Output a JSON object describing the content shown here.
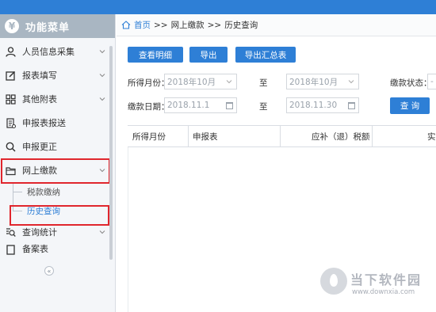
{
  "sidebar": {
    "title": "功能菜单",
    "logo_glyph": "¥",
    "items": [
      {
        "label": "人员信息采集",
        "icon": "person-icon",
        "chevron": true
      },
      {
        "label": "报表填写",
        "icon": "edit-icon",
        "chevron": true
      },
      {
        "label": "其他附表",
        "icon": "grid-icon",
        "chevron": true
      },
      {
        "label": "申报表报送",
        "icon": "document-icon",
        "chevron": false
      },
      {
        "label": "申报更正",
        "icon": "search-icon",
        "chevron": false
      },
      {
        "label": "网上缴款",
        "icon": "folder-icon",
        "chevron": true
      },
      {
        "label": "查询统计",
        "icon": "list-search-icon",
        "chevron": true
      },
      {
        "label": "备案表",
        "icon": "binder-icon",
        "chevron": true
      }
    ],
    "sub_items": [
      {
        "label": "税款缴纳",
        "active": false
      },
      {
        "label": "历史查询",
        "active": true
      }
    ],
    "collapse_glyph": "«"
  },
  "breadcrumb": {
    "home": "首页",
    "sep": ">>",
    "level1": "网上缴款",
    "level2": "历史查询"
  },
  "toolbar": {
    "view_detail": "查看明细",
    "export": "导出",
    "export_summary": "导出汇总表"
  },
  "filters": {
    "month_label": "所得月份：",
    "month_from": "2018年10月",
    "to_label": "至",
    "month_to": "2018年10月",
    "status_label": "缴款状态：",
    "status_value": "-",
    "date_label": "缴款日期：",
    "date_from": "2018.11.1",
    "date_to": "2018.11.30",
    "query_button": "查 询"
  },
  "table": {
    "columns": [
      "所得月份",
      "申报表",
      "应补（退）税额",
      "实"
    ]
  },
  "watermark": {
    "text": "当下软件园",
    "url": "www.downxia.com"
  },
  "colors": {
    "accent": "#2e7fd6",
    "highlight_box": "#e0262d",
    "menu_header": "#a9b6c2"
  }
}
